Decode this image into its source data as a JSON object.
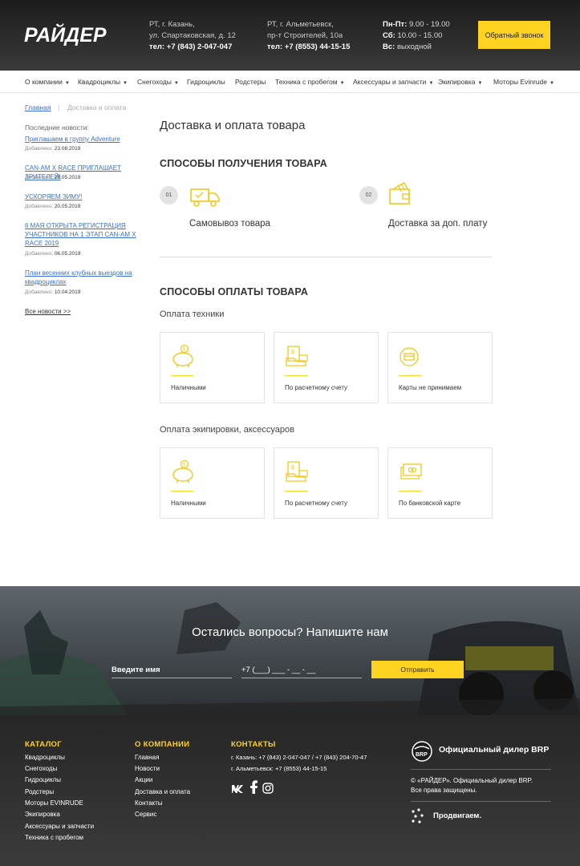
{
  "header": {
    "logo_text": "РАЙДЕР",
    "kazan": {
      "line1": "РТ, г. Казань,",
      "line2": "ул. Спартаковская, д. 12",
      "phone": "тел: +7 (843) 2-047-047"
    },
    "almet": {
      "line1": "РТ, г. Альметьевск,",
      "line2": "пр-т Строителей, 10а",
      "phone": "тел: +7 (8553) 44-15-15"
    },
    "hours": [
      {
        "day": "Пн-Пт:",
        "time": " 9.00 - 19.00"
      },
      {
        "day": "Сб:",
        "time": " 10.00 - 15.00"
      },
      {
        "day": "Вс:",
        "time": " выходной"
      }
    ],
    "callback_label": "Обратный звонок"
  },
  "nav": [
    {
      "label": "О компании",
      "arrow": "▼"
    },
    {
      "label": "Квадроциклы",
      "arrow": "▼"
    },
    {
      "label": "Снегоходы",
      "arrow": "▼"
    },
    {
      "label": "Гидроциклы",
      "arrow": ""
    },
    {
      "label": "Родстеры",
      "arrow": ""
    },
    {
      "label": "Техника с пробегом",
      "arrow": "▼"
    },
    {
      "label": "Аксессуары и запчасти",
      "arrow": "▼"
    },
    {
      "label": "Экипировка",
      "arrow": "▼"
    },
    {
      "label": "Моторы Evinrude",
      "arrow": "▼"
    }
  ],
  "breadcrumb": {
    "home": "Главная",
    "separator": "|",
    "current": "Доставка и оплата"
  },
  "sidebar": {
    "title": "Последние новости:",
    "date_prefix": "Добавлено: ",
    "news": [
      {
        "title": "Приглашаем в группу Adventure",
        "date": "23.08.2019"
      },
      {
        "title": "CAN-AM X RACE ПРИГЛАШАЕТ ЗРИТЕЛЕЙ!",
        "date": "28.05.2019"
      },
      {
        "title": "УСКОРЯЕМ ЗИМУ!",
        "date": "20.05.2019"
      },
      {
        "title": "6 МАЯ ОТКРЫТА РЕГИСТРАЦИЯ УЧАСТНИКОВ НА 1 ЭТАП CAN-AM X RACE 2019",
        "date": "06.05.2019"
      },
      {
        "title": "План весенних клубных выездов на квадроциклах",
        "date": "10.04.2019"
      }
    ],
    "all_news": "Все новости >>"
  },
  "main": {
    "title": "Доставка и оплата товара",
    "receive_title": "СПОСОБЫ ПОЛУЧЕНИЯ ТОВАРА",
    "receive": [
      {
        "num": "01",
        "label": "Самовывоз товара",
        "icon": "truck-icon"
      },
      {
        "num": "02",
        "label": "Доставка за доп. плату",
        "icon": "wallet-icon"
      }
    ],
    "pay_title": "СПОСОБЫ ОПЛАТЫ ТОВАРА",
    "tech_title": "Оплата техники",
    "tech_cards": [
      {
        "label": "Наличными",
        "icon": "piggy-bank-icon"
      },
      {
        "label": "По расчетному счету",
        "icon": "invoice-icon"
      },
      {
        "label": "Карты не принимаем",
        "icon": "no-card-icon"
      }
    ],
    "equip_title": "Оплата экипировки, аксессуаров",
    "equip_cards": [
      {
        "label": "Наличными",
        "icon": "piggy-bank-icon"
      },
      {
        "label": "По расчетному счету",
        "icon": "invoice-icon"
      },
      {
        "label": "По банковской карте",
        "icon": "bank-card-icon"
      }
    ]
  },
  "contact_form": {
    "title": "Остались вопросы? Напишите нам",
    "name_placeholder": "Введите имя",
    "phone_placeholder": "+7 (___) ___ - __ - __",
    "submit_label": "Отправить"
  },
  "footer": {
    "catalog_title": "КАТАЛОГ",
    "catalog": [
      "Квадроциклы",
      "Снегоходы",
      "Гидроциклы",
      "Родстеры",
      "Моторы EVINRUDE",
      "Экипировка",
      "Аксессуары и запчасти",
      "Техника с пробегом"
    ],
    "company_title": "О КОМПАНИИ",
    "company": [
      "Главная",
      "Новости",
      "Акции",
      "Доставка и оплата",
      "Контакты",
      "Сервис"
    ],
    "contacts_title": "КОНТАКТЫ",
    "contacts": [
      "г. Казань: +7 (843) 2-047-047 / +7 (843) 204-70-47",
      "г. Альметьевск: +7 (8553) 44-15-15"
    ],
    "dealer": "Официальный дилер BRP",
    "copyright_1": "© «РАЙДЕР». Официальный дилер BRP.",
    "copyright_2": "Все права защищены.",
    "developer": "Продвигаем."
  },
  "colors": {
    "accent": "#ffd31f",
    "link": "#3a6fd0",
    "header_bg": "#2a2a2a"
  }
}
